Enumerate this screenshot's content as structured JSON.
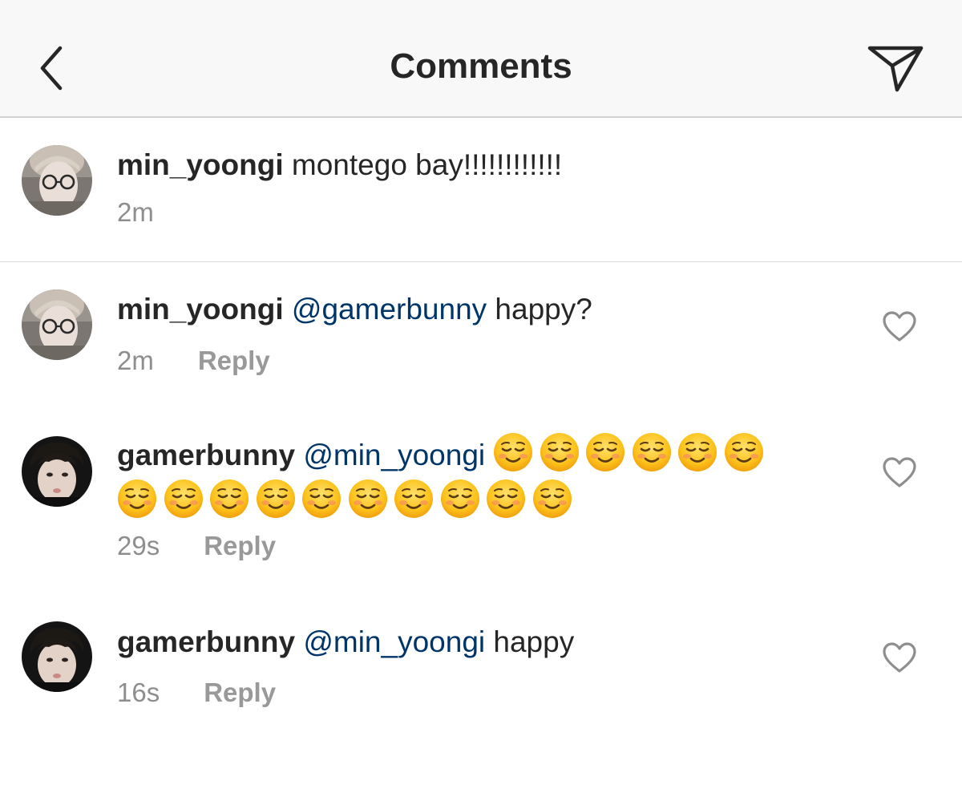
{
  "header": {
    "title": "Comments",
    "back_icon": "chevron-left-icon",
    "send_icon": "paper-plane-icon"
  },
  "caption": {
    "username": "min_yoongi",
    "text": " montego bay!!!!!!!!!!!!",
    "time": "2m"
  },
  "comments": [
    {
      "username": "min_yoongi",
      "mention": "@gamerbunny",
      "text": " happy?",
      "time": "2m",
      "reply_label": "Reply",
      "liked": false
    },
    {
      "username": "gamerbunny",
      "mention": "@min_yoongi",
      "text": "",
      "emoji": "☺️",
      "emoji_count": 16,
      "time": "29s",
      "reply_label": "Reply",
      "liked": false
    },
    {
      "username": "gamerbunny",
      "mention": "@min_yoongi",
      "text": " happy",
      "time": "16s",
      "reply_label": "Reply",
      "liked": false
    }
  ],
  "colors": {
    "text": "#262626",
    "mention": "#003569",
    "meta": "#8e8e8e",
    "divider": "#dbdbdb",
    "header_bg": "#f8f8f8"
  }
}
